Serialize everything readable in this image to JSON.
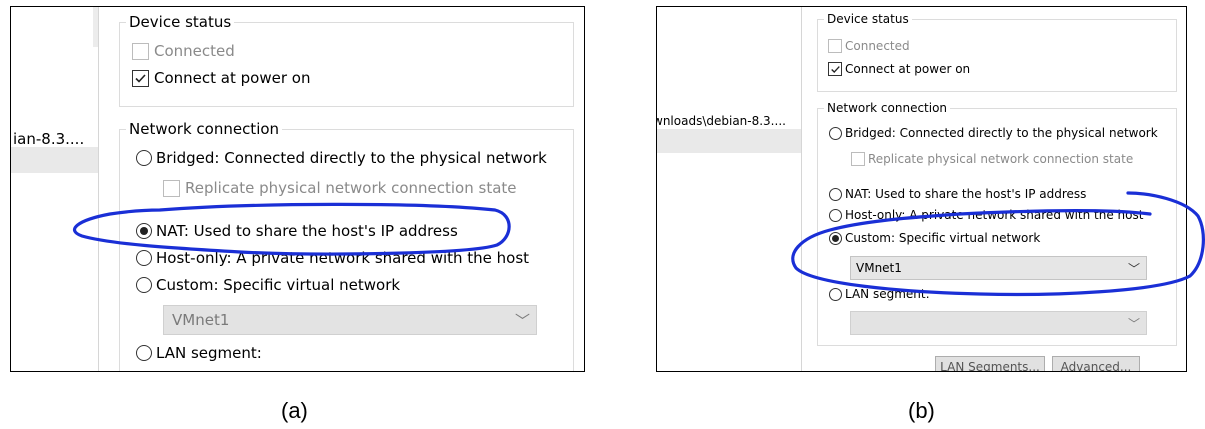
{
  "captions": {
    "a": "(a)",
    "b": "(b)"
  },
  "panel_a": {
    "sidebar_path": "ian-8.3....",
    "device_status": {
      "legend": "Device status",
      "connected_label": "Connected",
      "connect_power_label": "Connect at power on"
    },
    "network": {
      "legend": "Network connection",
      "bridged_label": "Bridged: Connected directly to the physical network",
      "replicate_label": "Replicate physical network connection state",
      "nat_label": "NAT: Used to share the host's IP address",
      "hostonly_label": "Host-only: A private network shared with the host",
      "custom_label": "Custom: Specific virtual network",
      "vmnet_value": "VMnet1",
      "lan_label": "LAN segment:"
    }
  },
  "panel_b": {
    "sidebar_path": "wnloads\\debian-8.3....",
    "device_status": {
      "legend": "Device status",
      "connected_label": "Connected",
      "connect_power_label": "Connect at power on"
    },
    "network": {
      "legend": "Network connection",
      "bridged_label": "Bridged: Connected directly to the physical network",
      "replicate_label": "Replicate physical network connection state",
      "nat_label": "NAT: Used to share the host's IP address",
      "hostonly_label": "Host-only: A private network shared with the host",
      "custom_label": "Custom: Specific virtual network",
      "vmnet_value": "VMnet1",
      "lan_label": "LAN segment:",
      "lan_segments_button": "LAN Segments...",
      "advanced_button": "Advanced..."
    }
  },
  "annotation_color": "#1a2fd6",
  "icons": {
    "checkmark": "check-icon",
    "dropdown": "chevron-down-icon"
  }
}
